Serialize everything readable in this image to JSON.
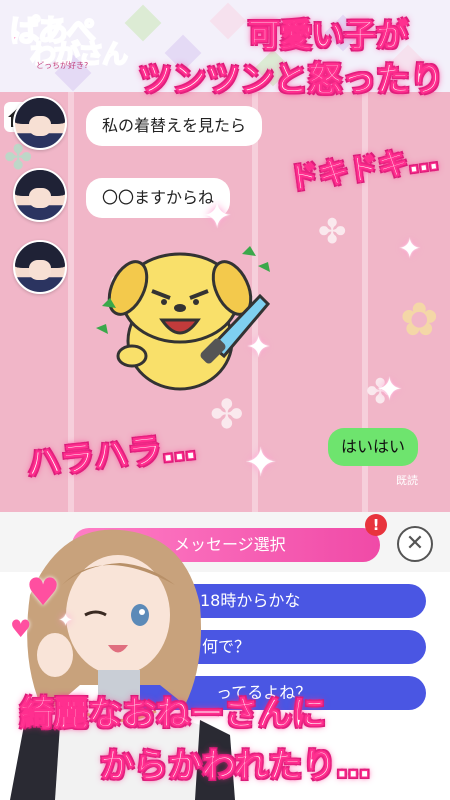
{
  "app": {
    "logo_line1": "ぱあぺ",
    "logo_line2": "わがさん",
    "logo_sub": "どっちが好き?"
  },
  "headlines": {
    "top1": "可愛い子が",
    "top2": "ツンツンと怒ったり",
    "doki": "ドキドキ…",
    "hara": "ハラハラ…",
    "bottom1": "綺麗なおねーさんに",
    "bottom2": "からかわれたり…"
  },
  "chat": {
    "messages": [
      {
        "text": "私の着替えを見たら"
      },
      {
        "text": "〇〇ますからね"
      }
    ],
    "reply": "はいはい",
    "read_label": "既読"
  },
  "choice": {
    "title": "メッセージ選択",
    "badge": "!",
    "close": "✕",
    "options": [
      "18時からかな",
      "何で？",
      "ってるよね？"
    ]
  },
  "colors": {
    "accent_pink": "#ff2f8f",
    "option_blue": "#4a56e3",
    "reply_green": "#6ee46e"
  },
  "icons": [
    "home-icon",
    "close-icon",
    "sparkle-icon",
    "heart-icon",
    "clover-icon"
  ]
}
